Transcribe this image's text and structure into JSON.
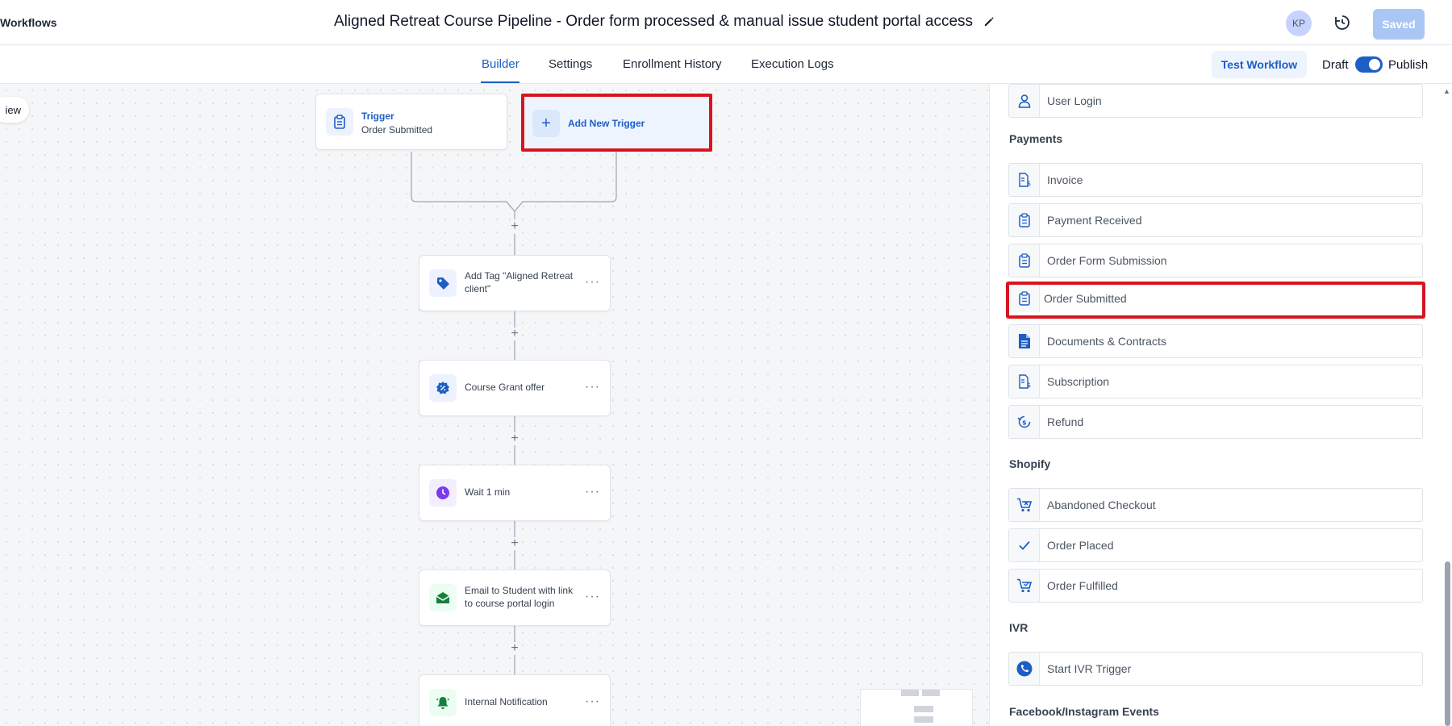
{
  "header": {
    "back_label": "Workflows",
    "title": "Aligned Retreat Course Pipeline - Order form processed & manual issue student portal access",
    "avatar_initials": "KP",
    "saved_label": "Saved"
  },
  "tabs": {
    "builder": "Builder",
    "settings": "Settings",
    "enrollment_history": "Enrollment History",
    "execution_logs": "Execution Logs",
    "active": "Builder"
  },
  "toolbar": {
    "test_workflow": "Test Workflow",
    "draft": "Draft",
    "publish": "Publish",
    "toggle_on": true
  },
  "canvas": {
    "view_label": "iew",
    "trigger": {
      "title": "Trigger",
      "subtitle": "Order Submitted"
    },
    "add_trigger_label": "Add New Trigger",
    "plus_symbol": "+",
    "steps": [
      {
        "label": "Add Tag \"Aligned Retreat client\"",
        "icon": "tag-icon",
        "color": "#1d5ec4"
      },
      {
        "label": "Course Grant offer",
        "icon": "badge-percent-icon",
        "color": "#1d5ec4"
      },
      {
        "label": "Wait 1 min",
        "icon": "clock-icon",
        "color": "#7c3aed"
      },
      {
        "label": "Email to Student with link to course portal login",
        "icon": "envelope-open-icon",
        "color": "#15803d"
      },
      {
        "label": "Internal Notification",
        "icon": "bell-icon",
        "color": "#15803d"
      }
    ]
  },
  "panel": {
    "items": {
      "user_login": "User Login",
      "invoice": "Invoice",
      "payment_received": "Payment Received",
      "order_form_submission": "Order Form Submission",
      "order_submitted": "Order Submitted",
      "documents_contracts": "Documents & Contracts",
      "subscription": "Subscription",
      "refund": "Refund",
      "abandoned_checkout": "Abandoned Checkout",
      "order_placed": "Order Placed",
      "order_fulfilled": "Order Fulfilled",
      "start_ivr": "Start IVR Trigger"
    },
    "sections": {
      "payments": "Payments",
      "shopify": "Shopify",
      "ivr": "IVR",
      "facebook": "Facebook/Instagram Events"
    }
  },
  "colors": {
    "accent": "#1d5ec4",
    "highlight": "#d7151e"
  }
}
